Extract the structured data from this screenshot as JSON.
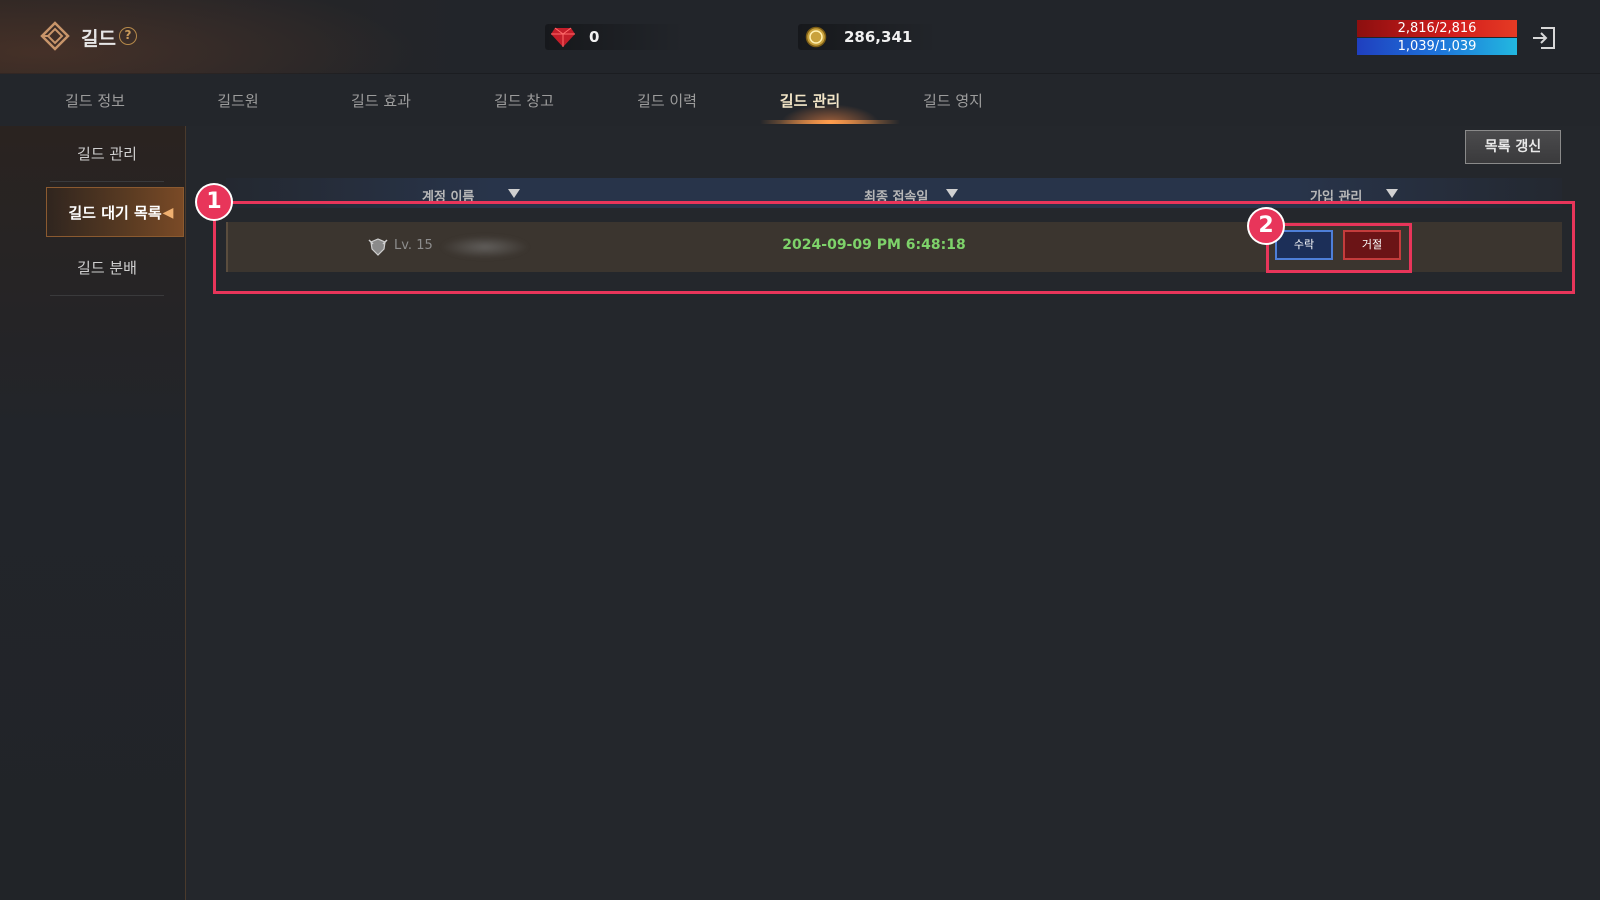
{
  "header": {
    "title": "길드",
    "help_symbol": "?",
    "gem_amount": "0",
    "gold_amount": "286,341",
    "hp": "2,816/2,816",
    "mp": "1,039/1,039",
    "icons": {
      "guild": "guild-emblem-icon",
      "help": "help-icon",
      "gem": "red-gem-icon",
      "gold": "gold-coin-icon",
      "exit": "exit-icon"
    }
  },
  "tabs": [
    {
      "label": "길드 정보",
      "active": false
    },
    {
      "label": "길드원",
      "active": false
    },
    {
      "label": "길드 효과",
      "active": false
    },
    {
      "label": "길드 창고",
      "active": false
    },
    {
      "label": "길드 이력",
      "active": false
    },
    {
      "label": "길드 관리",
      "active": true
    },
    {
      "label": "길드 영지",
      "active": false
    }
  ],
  "sidebar": {
    "items": [
      {
        "label": "길드 관리",
        "active": false
      },
      {
        "label": "길드 대기 목록",
        "active": true
      },
      {
        "label": "길드 분배",
        "active": false
      }
    ]
  },
  "main": {
    "refresh_label": "목록 갱신",
    "columns": [
      "계정 이름",
      "최종 접속일",
      "가입 관리"
    ],
    "rows": [
      {
        "level": "Lv. 15",
        "last_login": "2024-09-09 PM 6:48:18",
        "accept_label": "수락",
        "reject_label": "거절"
      }
    ]
  },
  "annotations": {
    "badge_1": "1",
    "badge_2": "2",
    "highlight_color": "#e8355a"
  },
  "colors": {
    "accent_orange": "#ff9d4d",
    "login_green": "#7ed36a",
    "hp_red": "#d21d1d",
    "mp_blue": "#1e73d9"
  }
}
